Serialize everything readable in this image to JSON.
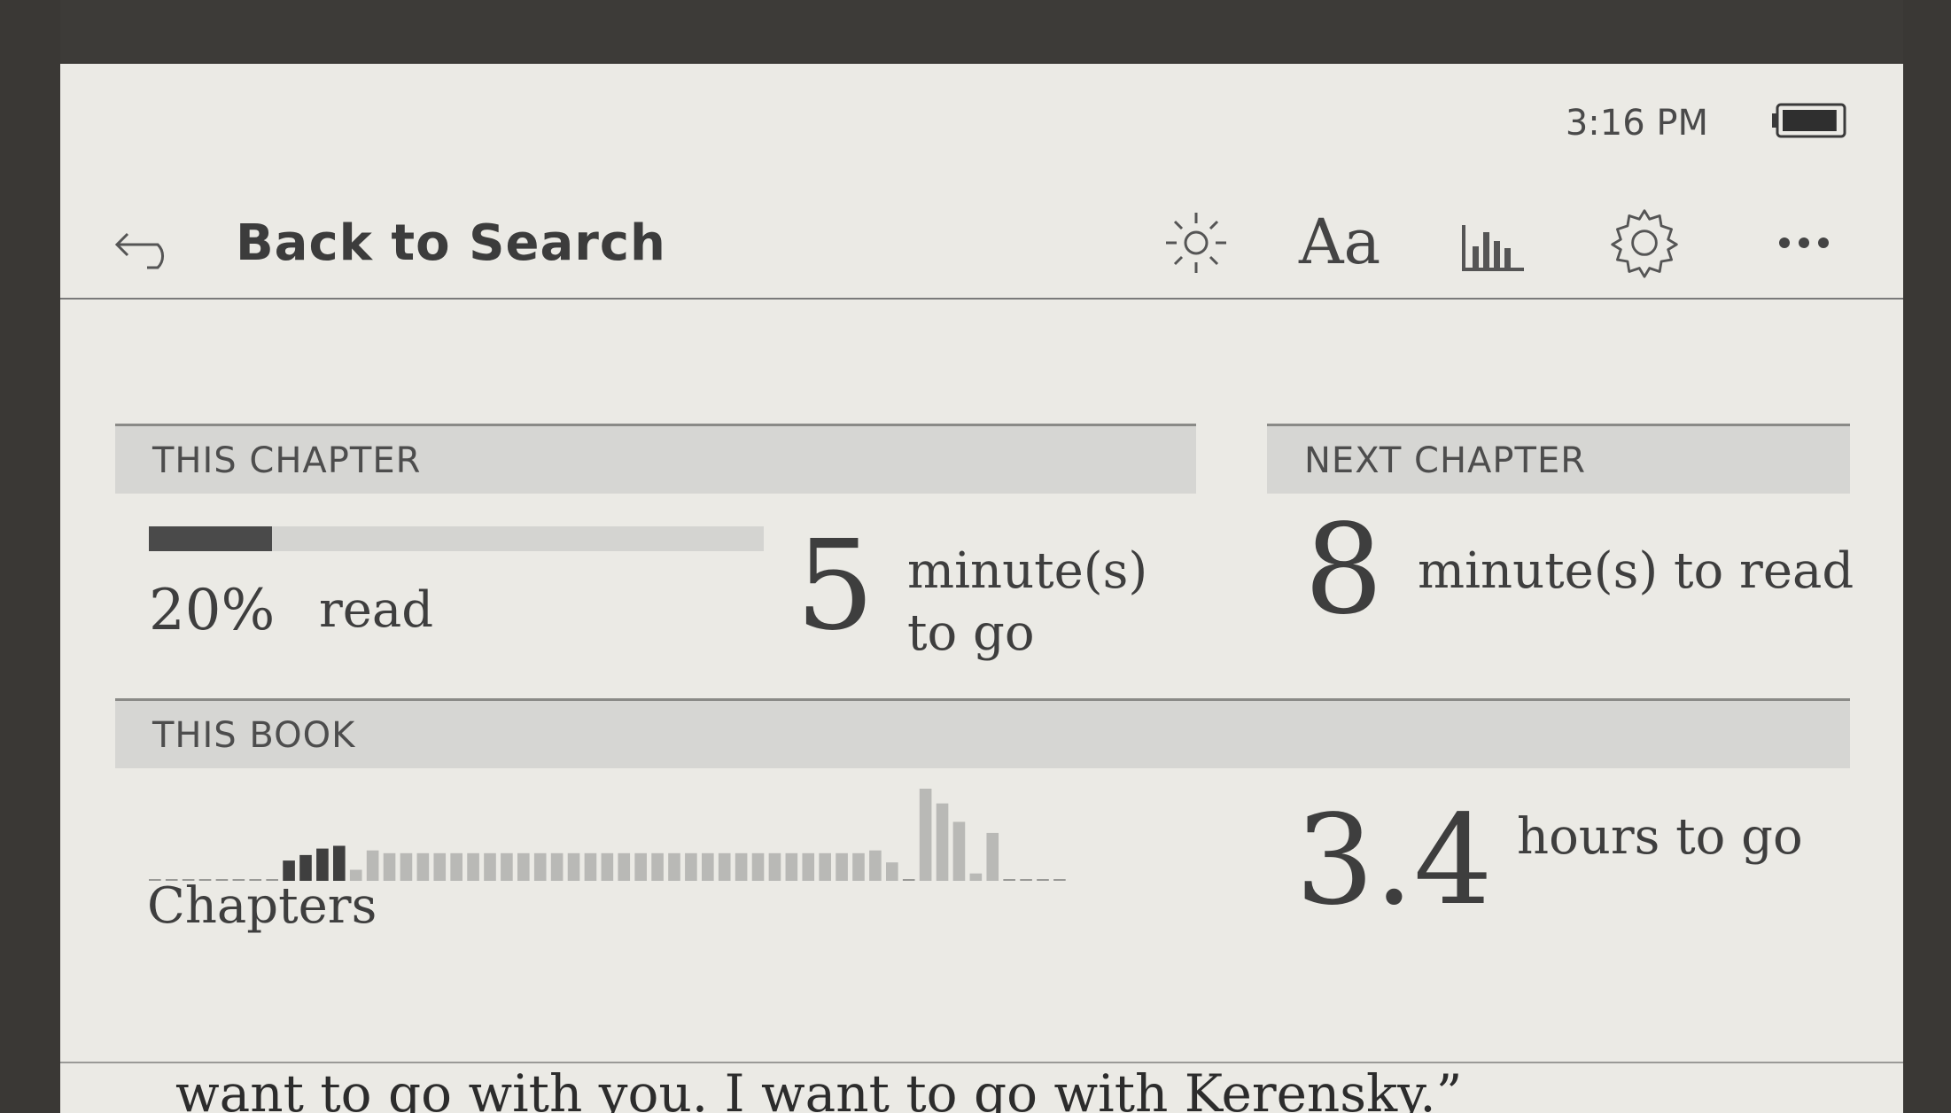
{
  "status": {
    "time": "3:16 PM",
    "battery_level": 0.95
  },
  "toolbar": {
    "back_label": "Back to Search",
    "font_label": "Aa",
    "icons": [
      "back-arrow-icon",
      "brightness-icon",
      "font-icon",
      "stats-icon",
      "gear-icon",
      "more-icon"
    ]
  },
  "this_chapter": {
    "header": "THIS CHAPTER",
    "progress": 0.2,
    "percent": "20%",
    "read_label": "read",
    "minutes": "5",
    "minutes_label_1": "minute(s)",
    "minutes_label_2": "to go"
  },
  "next_chapter": {
    "header": "NEXT CHAPTER",
    "minutes": "8",
    "minutes_label": "minute(s) to read"
  },
  "this_book": {
    "header": "THIS BOOK",
    "chapters_label": "Chapters",
    "hours": "3.4",
    "hours_label": "hours to go"
  },
  "chart_data": {
    "type": "bar",
    "title": "",
    "xlabel": "Chapters",
    "ylabel": "",
    "bars": [
      0,
      0,
      0,
      0,
      0,
      0,
      0,
      0,
      0.22,
      0.28,
      0.35,
      0.38,
      0.12,
      0.33,
      0.3,
      0.3,
      0.3,
      0.3,
      0.3,
      0.3,
      0.3,
      0.3,
      0.3,
      0.3,
      0.3,
      0.3,
      0.3,
      0.3,
      0.3,
      0.3,
      0.3,
      0.3,
      0.3,
      0.3,
      0.3,
      0.3,
      0.3,
      0.3,
      0.3,
      0.3,
      0.3,
      0.3,
      0.3,
      0.33,
      0.2,
      0,
      1.0,
      0.84,
      0.64,
      0.08,
      0.52,
      0,
      0,
      0,
      0
    ],
    "read_chapters": 12,
    "colors": {
      "read": "#3f3f3f",
      "unread": "#b9b9b6"
    }
  },
  "page_text": "want to go with you. I want to go with Kerensky.”"
}
